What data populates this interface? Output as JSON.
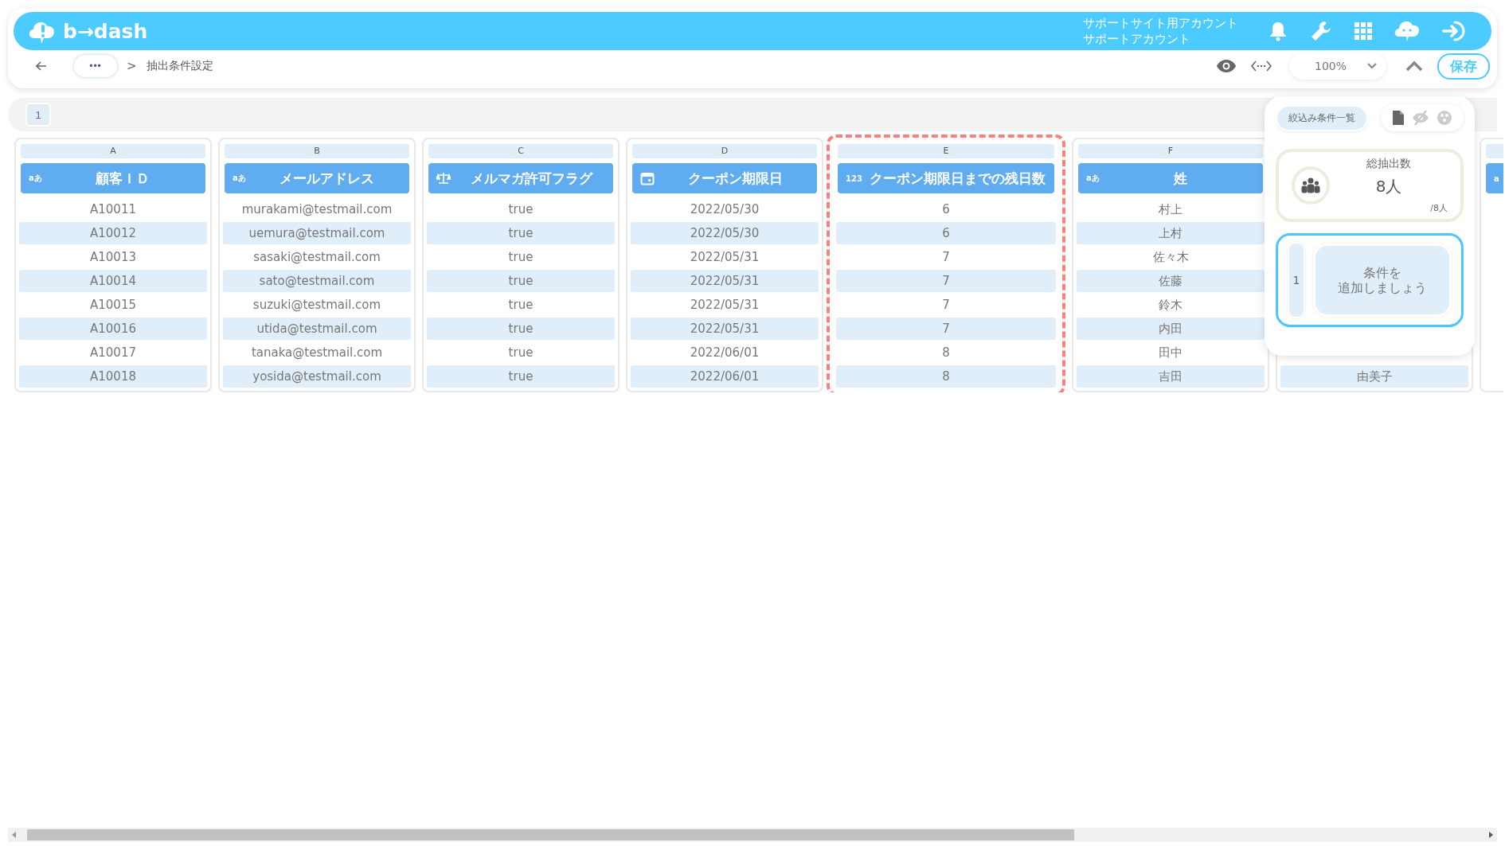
{
  "header": {
    "logo": "b→dash",
    "account_lines": [
      "サポートサイト用アカウント",
      "サポートアカウント"
    ]
  },
  "nav": {
    "more": "•••",
    "separator": ">",
    "breadcrumb": "抽出条件設定",
    "zoom": "100%",
    "save": "保存"
  },
  "sheet_tabs": [
    {
      "label": "1",
      "selected": true
    }
  ],
  "columns": [
    {
      "letter": "A",
      "kind": "text",
      "type_glyph": "aあ",
      "title": "顧客ＩＤ",
      "highlighted": false,
      "cells": [
        "A10011",
        "A10012",
        "A10013",
        "A10014",
        "A10015",
        "A10016",
        "A10017",
        "A10018"
      ]
    },
    {
      "letter": "B",
      "kind": "text",
      "type_glyph": "aあ",
      "title": "メールアドレス",
      "highlighted": false,
      "cells": [
        "murakami@testmail.com",
        "uemura@testmail.com",
        "sasaki@testmail.com",
        "sato@testmail.com",
        "suzuki@testmail.com",
        "utida@testmail.com",
        "tanaka@testmail.com",
        "yosida@testmail.com"
      ]
    },
    {
      "letter": "C",
      "kind": "flag",
      "title": "メルマガ許可フラグ",
      "highlighted": false,
      "cells": [
        "true",
        "true",
        "true",
        "true",
        "true",
        "true",
        "true",
        "true"
      ]
    },
    {
      "letter": "D",
      "kind": "date",
      "title": "クーポン期限日",
      "highlighted": false,
      "cells": [
        "2022/05/30",
        "2022/05/30",
        "2022/05/31",
        "2022/05/31",
        "2022/05/31",
        "2022/05/31",
        "2022/06/01",
        "2022/06/01"
      ]
    },
    {
      "letter": "E",
      "kind": "number",
      "type_glyph": "123",
      "title": "クーポン期限日までの残日数",
      "highlighted": true,
      "cells": [
        "6",
        "6",
        "7",
        "7",
        "7",
        "7",
        "8",
        "8"
      ]
    },
    {
      "letter": "F",
      "kind": "text",
      "type_glyph": "aあ",
      "title": "姓",
      "highlighted": false,
      "cells": [
        "村上",
        "上村",
        "佐々木",
        "佐藤",
        "鈴木",
        "内田",
        "田中",
        "吉田"
      ]
    },
    {
      "kind": "text",
      "highlighted": false,
      "last_cell": "由美子"
    },
    {
      "kind": "text",
      "type_glyph": "a",
      "highlighted": false
    }
  ],
  "panel": {
    "tab": "絞込み条件一覧",
    "count_label": "総抽出数",
    "count": "8人",
    "total": "/8人",
    "conditions": [
      {
        "number": "1",
        "prompt_lines": [
          "条件を",
          "追加しましょう"
        ]
      }
    ]
  }
}
